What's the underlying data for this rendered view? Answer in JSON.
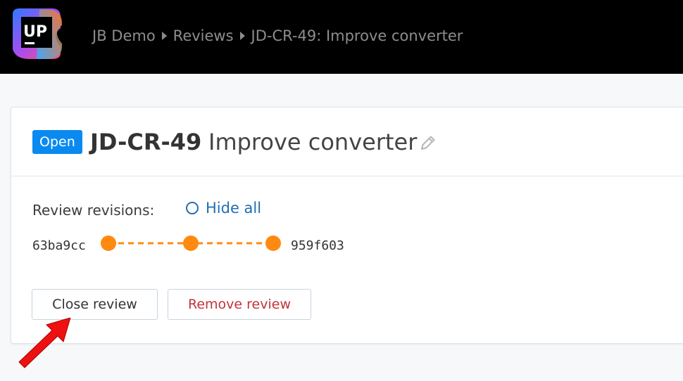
{
  "header": {
    "logo_text": "UP",
    "breadcrumb": [
      "JB Demo",
      "Reviews",
      "JD-CR-49: Improve converter"
    ]
  },
  "review": {
    "status": "Open",
    "id": "JD-CR-49",
    "title": "Improve converter",
    "revisions_label": "Review revisions:",
    "hide_all_label": "Hide all",
    "revision_start": "63ba9cc",
    "revision_end": "959f603",
    "revision_count": 3
  },
  "actions": {
    "close_label": "Close review",
    "remove_label": "Remove review"
  },
  "colors": {
    "accent": "#0a8af0",
    "revision_dot": "#ff8a10",
    "danger": "#c0343b",
    "link": "#1f6fb4",
    "annotation_arrow": "#ee1111"
  }
}
